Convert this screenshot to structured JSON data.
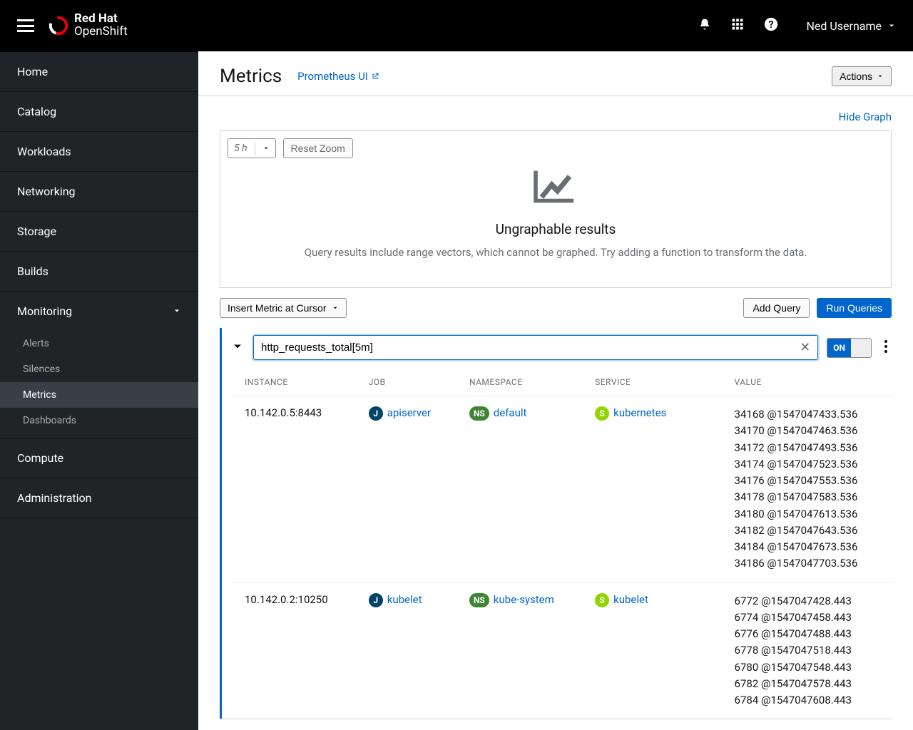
{
  "brand": {
    "line1": "Red Hat",
    "line2": "OpenShift"
  },
  "user": "Ned Username",
  "sidebar": {
    "items": [
      {
        "label": "Home"
      },
      {
        "label": "Catalog"
      },
      {
        "label": "Workloads"
      },
      {
        "label": "Networking"
      },
      {
        "label": "Storage"
      },
      {
        "label": "Builds"
      },
      {
        "label": "Monitoring",
        "expanded": true,
        "children": [
          {
            "label": "Alerts"
          },
          {
            "label": "Silences"
          },
          {
            "label": "Metrics",
            "active": true
          },
          {
            "label": "Dashboards"
          }
        ]
      },
      {
        "label": "Compute"
      },
      {
        "label": "Administration"
      }
    ]
  },
  "page": {
    "title": "Metrics",
    "prometheus_link": "Prometheus UI",
    "actions_label": "Actions",
    "hide_graph": "Hide Graph"
  },
  "graph": {
    "timewindow": "5 h",
    "reset": "Reset Zoom",
    "empty_title": "Ungraphable results",
    "empty_body": "Query results include range vectors, which cannot be graphed. Try adding a function to transform the data."
  },
  "toolbar": {
    "insert": "Insert Metric at Cursor",
    "add": "Add Query",
    "run": "Run Queries"
  },
  "query": {
    "value": "http_requests_total[5m]",
    "toggle": "ON"
  },
  "table": {
    "headers": [
      "INSTANCE",
      "JOB",
      "NAMESPACE",
      "SERVICE",
      "VALUE"
    ],
    "rows": [
      {
        "instance": "10.142.0.5:8443",
        "job": "apiserver",
        "namespace": "default",
        "service": "kubernetes",
        "values": [
          "34168 @1547047433.536",
          "34170 @1547047463.536",
          "34172 @1547047493.536",
          "34174 @1547047523.536",
          "34176 @1547047553.536",
          "34178 @1547047583.536",
          "34180 @1547047613.536",
          "34182 @1547047643.536",
          "34184 @1547047673.536",
          "34186 @1547047703.536"
        ]
      },
      {
        "instance": "10.142.0.2:10250",
        "job": "kubelet",
        "namespace": "kube-system",
        "service": "kubelet",
        "values": [
          "6772 @1547047428.443",
          "6774 @1547047458.443",
          "6776 @1547047488.443",
          "6778 @1547047518.443",
          "6780 @1547047548.443",
          "6782 @1547047578.443",
          "6784 @1547047608.443"
        ]
      }
    ]
  }
}
